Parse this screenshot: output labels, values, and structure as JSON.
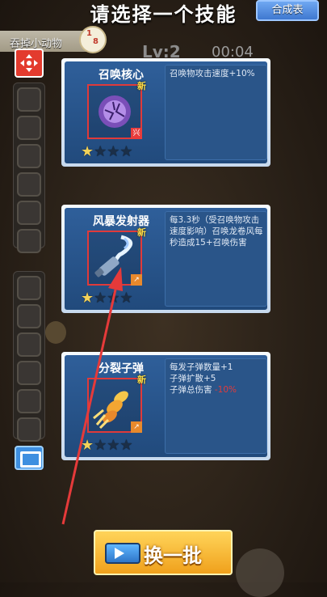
{
  "header": {
    "title": "请选择一个技能",
    "combine_button": "合成表"
  },
  "quest": {
    "label": "吞掉小动物",
    "count_top": "1",
    "count_bottom": "8"
  },
  "level": "Lv:2",
  "timer": "00:04",
  "skills": [
    {
      "name": "召唤核心",
      "badge": "新",
      "tag": "兴",
      "stars_filled": 1,
      "stars_total": 4,
      "desc": "召唤物攻击速度+10%",
      "icon": "purple-orb-icon"
    },
    {
      "name": "风暴发射器",
      "badge": "新",
      "tag": "",
      "stars_filled": 1,
      "stars_total": 4,
      "desc": "每3.3秒（受召唤物攻击速度影响）召唤龙卷风每秒造成15+召唤伤害",
      "icon": "tornado-launcher-icon"
    },
    {
      "name": "分裂子弹",
      "badge": "新",
      "tag": "",
      "stars_filled": 1,
      "stars_total": 4,
      "desc_lines": [
        "每发子弹数量+1",
        "子弹扩散+5",
        "子弹总伤害"
      ],
      "desc_red": "-10%",
      "icon": "flaming-bullet-icon"
    }
  ],
  "refresh_button": "换一批",
  "colors": {
    "accent_yellow": "#f0a11c",
    "card_blue": "#2f5f9a",
    "highlight_red": "#e03a3a",
    "star": "#f2d25a"
  }
}
